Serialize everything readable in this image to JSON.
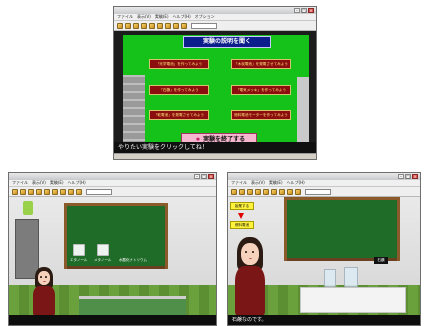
{
  "windows": {
    "top": {
      "title": "",
      "menu": [
        "ファイル",
        "表示(V)",
        "実験(E)",
        "ヘルプ(H)",
        "オプション"
      ],
      "heading": "実験の説明を聞く",
      "experiments": [
        "「光学電池」を作ってみよう",
        "「木炭電池」を発電させてみよう",
        "「石鹸」を作ってみよう",
        "「電気メッキ」を作ってみよう",
        "「乾電池」を発電させてみよう",
        "燃料電池モーターを作ってみよう"
      ],
      "end_button": "実験を終了する",
      "subtitle": "やりたい実験をクリックしてね！"
    },
    "bottom_left": {
      "title": "",
      "menu": [
        "ファイル",
        "表示(V)",
        "実験(E)",
        "ヘルプ(H)"
      ],
      "jar_labels": [
        "エタノール",
        "メタノール",
        "水酸化ナトリウム"
      ],
      "caption": ""
    },
    "bottom_right": {
      "title": "",
      "menu": [
        "ファイル",
        "表示(V)",
        "実験(E)",
        "ヘルプ(H)"
      ],
      "side_buttons": [
        "始業する",
        "燃料電池"
      ],
      "table_badge": "石鹸",
      "caption": "石鹸なのです。"
    }
  },
  "icons": {
    "toolbar": "folder-icon",
    "window_controls": [
      "minimize-icon",
      "maximize-icon",
      "close-icon"
    ]
  },
  "colors": {
    "menu_panel": "#14c21a",
    "experiment_button": "#8c0d0d",
    "experiment_text": "#ffe27a",
    "heading_button": "#0c1d8c",
    "end_button": "#f5b7cf",
    "chalkboard": "#1f6b28",
    "presenter_top": "#7a1616"
  }
}
